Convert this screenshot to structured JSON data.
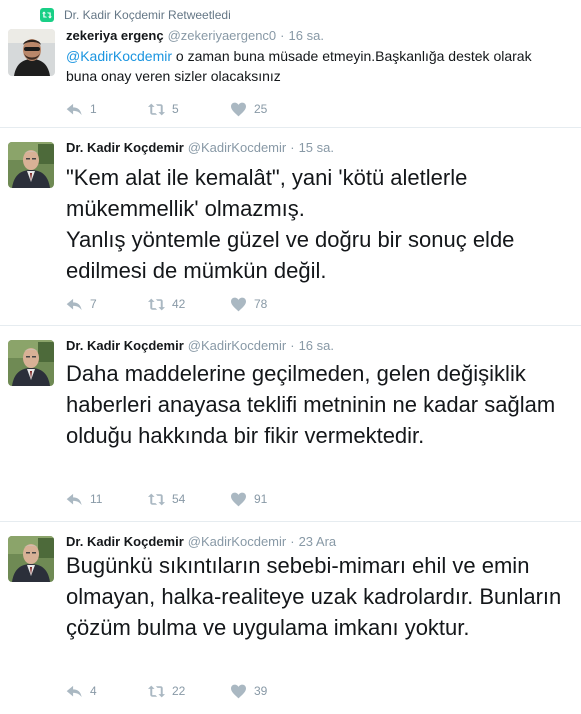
{
  "retweet_context": {
    "label": "Dr. Kadir Koçdemir Retweetledi",
    "icon": "retweet-icon"
  },
  "tweets": [
    {
      "fullname": "zekeriya ergenç",
      "username": "@zekeriyaergenc0",
      "time": "16 sa.",
      "mention": "@KadirKocdemir",
      "text": " o zaman buna müsade etmeyin.Başkanlığa destek olarak buna onay veren sizler olacaksınız",
      "replies": "1",
      "retweets": "5",
      "likes": "25"
    },
    {
      "fullname": "Dr. Kadir Koçdemir",
      "username": "@KadirKocdemir",
      "time": "15 sa.",
      "text": "\"Kem alat ile kemalât\", yani 'kötü aletlerle mükemmellik' olmazmış.\nYanlış yöntemle güzel ve doğru bir sonuç elde edilmesi de mümkün değil.",
      "replies": "7",
      "retweets": "42",
      "likes": "78"
    },
    {
      "fullname": "Dr. Kadir Koçdemir",
      "username": "@KadirKocdemir",
      "time": "16 sa.",
      "text": "Daha maddelerine geçilmeden, gelen değişiklik haberleri anayasa teklifi metninin ne kadar sağlam olduğu hakkında bir fikir vermektedir.",
      "replies": "11",
      "retweets": "54",
      "likes": "91"
    },
    {
      "fullname": "Dr. Kadir Koçdemir",
      "username": "@KadirKocdemir",
      "time": "23 Ara",
      "text": "Bugünkü sıkıntıların sebebi-mimarı ehil ve emin olmayan, halka-realiteye uzak kadrolardır. Bunların çözüm bulma ve uygulama imkanı yoktur.",
      "replies": "4",
      "retweets": "22",
      "likes": "39"
    }
  ],
  "colors": {
    "link": "#1b95e0",
    "muted": "#8899a6",
    "retweet_green": "#19cf86",
    "border": "#e6ecf0"
  }
}
